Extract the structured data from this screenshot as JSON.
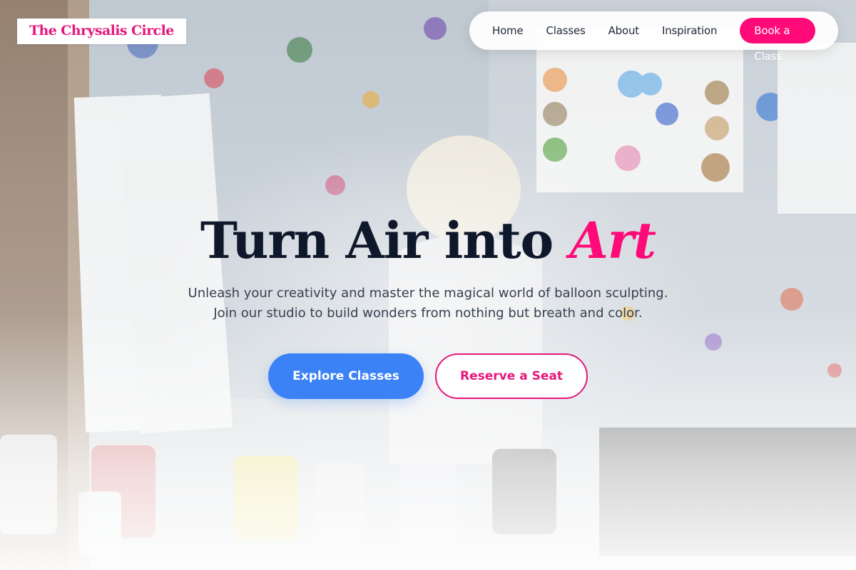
{
  "brand": {
    "name": "The Chrysalis Circle",
    "accent_color": "#ff0a78",
    "primary_color": "#3b82f6"
  },
  "nav": {
    "items": [
      {
        "label": "Home"
      },
      {
        "label": "Classes"
      },
      {
        "label": "About"
      },
      {
        "label": "Inspiration"
      }
    ],
    "cta_label": "Book a Class"
  },
  "hero": {
    "headline_main": "Turn Air into",
    "headline_accent": "Art",
    "subtitle": "Unleash your creativity and master the magical world of balloon sculpting. Join our studio to build wonders from nothing but breath and color.",
    "primary_cta": "Explore Classes",
    "secondary_cta": "Reserve a Seat"
  }
}
